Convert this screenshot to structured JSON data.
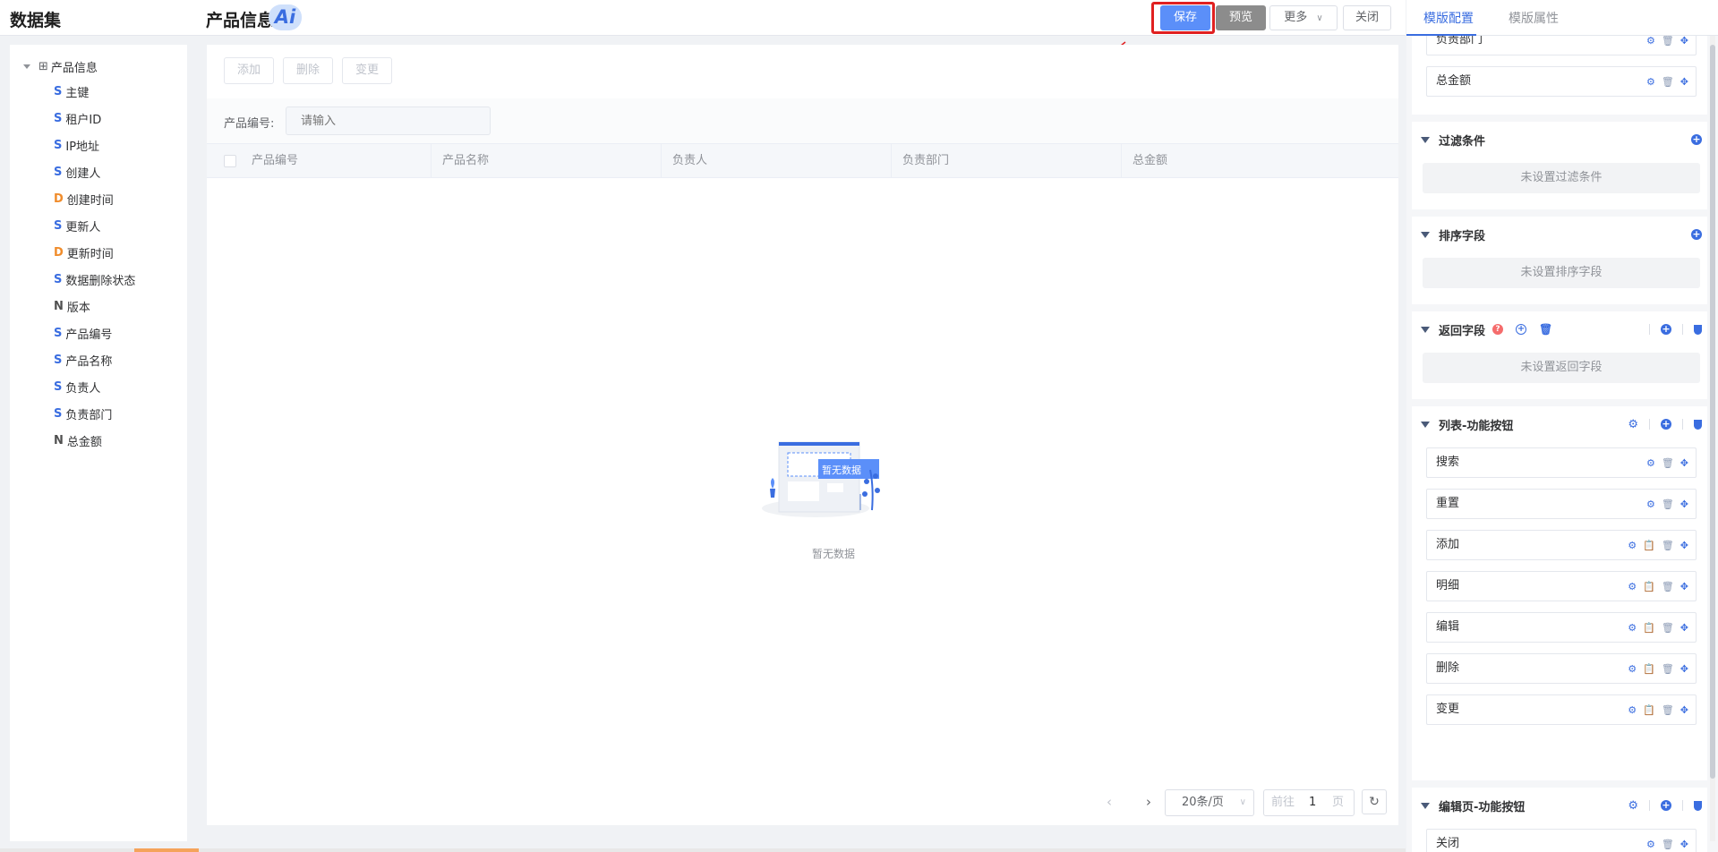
{
  "header": {
    "app_title": "数据集",
    "page_title": "产品信息",
    "ai_badge": "Ai",
    "save_label": "保存",
    "preview_label": "预览",
    "more_label": "更多",
    "close_label": "关闭"
  },
  "sidebar": {
    "root": "产品信息",
    "items": [
      {
        "type": "S",
        "label": "主键"
      },
      {
        "type": "S",
        "label": "租户ID"
      },
      {
        "type": "S",
        "label": "IP地址"
      },
      {
        "type": "S",
        "label": "创建人"
      },
      {
        "type": "D",
        "label": "创建时间"
      },
      {
        "type": "S",
        "label": "更新人"
      },
      {
        "type": "D",
        "label": "更新时间"
      },
      {
        "type": "S",
        "label": "数据删除状态"
      },
      {
        "type": "N",
        "label": "版本"
      },
      {
        "type": "S",
        "label": "产品编号"
      },
      {
        "type": "S",
        "label": "产品名称"
      },
      {
        "type": "S",
        "label": "负责人"
      },
      {
        "type": "S",
        "label": "负责部门"
      },
      {
        "type": "N",
        "label": "总金额"
      }
    ]
  },
  "main": {
    "toolbar": {
      "add": "添加",
      "delete": "删除",
      "change": "变更"
    },
    "search": {
      "label": "产品编号:",
      "placeholder": "请输入"
    },
    "columns": [
      "产品编号",
      "产品名称",
      "负责人",
      "负责部门",
      "总金额"
    ],
    "empty_illustration_text": "暂无数据",
    "empty_text": "暂无数据",
    "pager": {
      "page_size": "20条/页",
      "goto_prefix": "前往",
      "page": "1",
      "goto_suffix": "页"
    }
  },
  "right_panel": {
    "tabs": [
      "模版配置",
      "模版属性"
    ],
    "top_fields": [
      "负责部门",
      "总金额"
    ],
    "filter": {
      "title": "过滤条件",
      "empty": "未设置过滤条件"
    },
    "sort": {
      "title": "排序字段",
      "empty": "未设置排序字段"
    },
    "return_fields": {
      "title": "返回字段",
      "help": "?",
      "empty": "未设置返回字段"
    },
    "list_buttons": {
      "title": "列表-功能按钮",
      "items": [
        "搜索",
        "重置",
        "添加",
        "明细",
        "编辑",
        "删除",
        "变更"
      ]
    },
    "edit_buttons": {
      "title": "编辑页-功能按钮",
      "items": [
        "关闭"
      ]
    }
  },
  "colors": {
    "accent": "#3a6de0",
    "save": "#5b8ff9",
    "highlight": "#e02020"
  }
}
